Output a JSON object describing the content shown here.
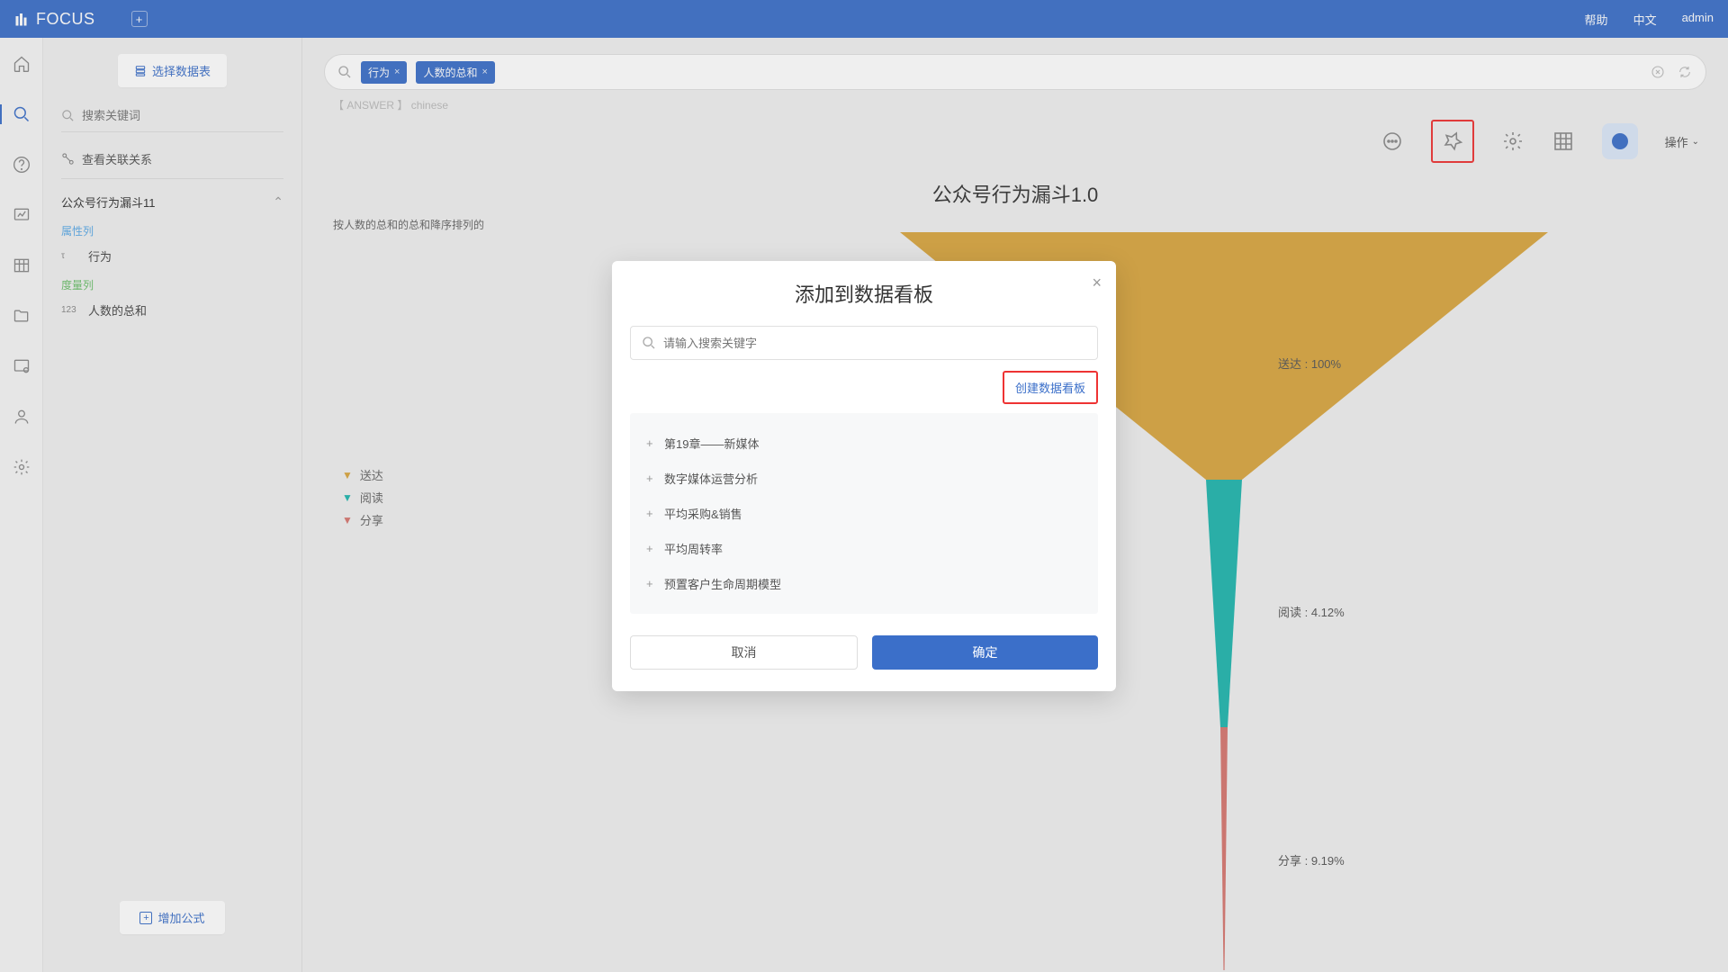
{
  "topbar": {
    "brand": "FOCUS",
    "help": "帮助",
    "lang": "中文",
    "user": "admin"
  },
  "sidebar": {
    "select_ds": "选择数据表",
    "search_placeholder": "搜索关键词",
    "relation": "查看关联关系",
    "dataset": "公众号行为漏斗11",
    "attr_section": "属性列",
    "metric_section": "度量列",
    "attr_field": "行为",
    "metric_field": "人数的总和",
    "add_formula": "增加公式"
  },
  "query": {
    "pill1": "行为",
    "pill2": "人数的总和",
    "answer_prefix": "【 ANSWER 】",
    "answer_lang": "chinese"
  },
  "chart": {
    "title": "公众号行为漏斗1.0",
    "sort_note": "按人数的总和的总和降序排列的",
    "ops": "操作"
  },
  "legend": {
    "l1": "送达",
    "l2": "阅读",
    "l3": "分享"
  },
  "funnel_labels": {
    "l1": "送达  :  100%",
    "l2": "阅读  :  4.12%",
    "l3": "分享  :  9.19%"
  },
  "chart_data": {
    "type": "funnel",
    "title": "公众号行为漏斗1.0",
    "series": [
      {
        "name": "送达",
        "percent": 100,
        "color": "#d9a63f"
      },
      {
        "name": "阅读",
        "percent": 4.12,
        "color": "#1fb6ae"
      },
      {
        "name": "分享",
        "percent": 9.19,
        "color": "#d7766f"
      }
    ]
  },
  "modal": {
    "title": "添加到数据看板",
    "search_placeholder": "请输入搜索关键字",
    "create": "创建数据看板",
    "items": {
      "i0": "第19章——新媒体",
      "i1": "数字媒体运营分析",
      "i2": "平均采购&销售",
      "i3": "平均周转率",
      "i4": "预置客户生命周期模型"
    },
    "cancel": "取消",
    "ok": "确定"
  }
}
